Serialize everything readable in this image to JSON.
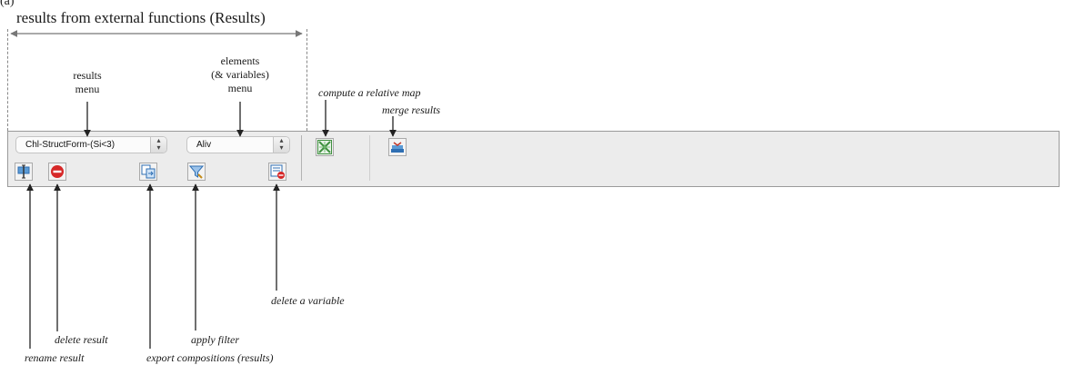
{
  "figure_letter": "(a)",
  "title": "results from external functions (Results)",
  "callouts": {
    "results_menu": [
      "results",
      "menu"
    ],
    "elements_menu": [
      "elements",
      "(& variables)",
      "menu"
    ]
  },
  "labels": {
    "compute_relative_map": "compute a relative map",
    "merge_results": "merge results",
    "delete_variable": "delete a variable",
    "delete_result": "delete result",
    "apply_filter": "apply filter",
    "rename_result": "rename result",
    "export_compositions": "export compositions (results)"
  },
  "toolbar": {
    "results_select": "Chl-StructForm-(Si<3)",
    "elements_select": "Aliv"
  },
  "icons": [
    "rename-icon",
    "delete-result-icon",
    "export-icon",
    "filter-icon",
    "delete-variable-icon",
    "relative-map-icon",
    "merge-results-icon"
  ],
  "colors": {
    "delete": "#d62828",
    "toolbar": "#ececec",
    "accent_blue": "#2f6fb3",
    "map_green": "#3f8f3f"
  }
}
